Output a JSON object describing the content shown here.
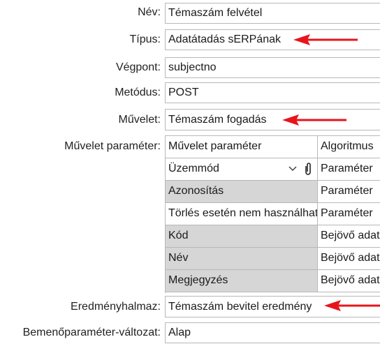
{
  "form": {
    "nev": {
      "label": "Név:",
      "value": "Témaszám felvétel"
    },
    "tipus": {
      "label": "Típus:",
      "value": "Adatátadás sERPának"
    },
    "vegpont": {
      "label": "Végpont:",
      "value": "subjectno"
    },
    "metodus": {
      "label": "Metódus:",
      "value": "POST"
    },
    "muvelet": {
      "label": "Művelet:",
      "value": "Témaszám fogadás"
    },
    "muvelet_parameter": {
      "label": "Művelet paraméter:"
    },
    "eredmenyhalmaz": {
      "label": "Eredményhalmaz:",
      "value": "Témaszám bevitel eredmény"
    },
    "bemeno": {
      "label": "Bemenőparaméter-változat:",
      "value": "Alap"
    }
  },
  "grid": {
    "headers": [
      "Művelet paraméter",
      "Algoritmus"
    ],
    "rows": [
      {
        "param": "Üzemmód",
        "algo": "Paraméter"
      },
      {
        "param": "Azonosítás",
        "algo": "Paraméter"
      },
      {
        "param": "Törlés esetén nem használható",
        "algo": "Paraméter"
      },
      {
        "param": "Kód",
        "algo": "Bejövő adat"
      },
      {
        "param": "Név",
        "algo": "Bejövő adat"
      },
      {
        "param": "Megjegyzés",
        "algo": "Bejövő adat"
      }
    ]
  },
  "icons": {
    "dropdown": "chevron-down-icon",
    "attach": "paperclip-icon",
    "annotation": "red-arrow-icon"
  },
  "colors": {
    "arrow": "#e8141c",
    "row_gray": "#d6d6d6",
    "border": "#b8b8b8"
  }
}
